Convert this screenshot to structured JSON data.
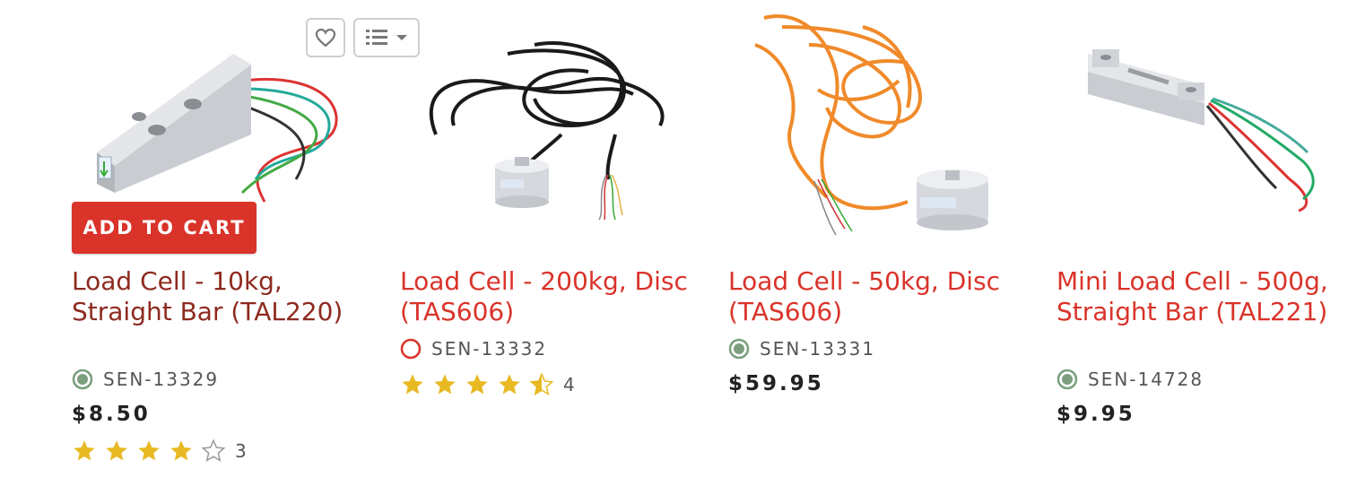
{
  "actions": {
    "add_to_cart_label": "ADD TO CART",
    "wishlist_icon": "heart-icon",
    "list_icon": "list-icon",
    "dropdown_icon": "caret-down-icon"
  },
  "colors": {
    "brand_red": "#d9332a",
    "visited_red": "#8e2a1f",
    "in_stock_green": "#7a9e7e",
    "out_of_stock_red": "#d9332a",
    "star_gold": "#e8b923"
  },
  "products": [
    {
      "title": "Load Cell - 10kg, Straight Bar (TAL220)",
      "sku": "SEN-13329",
      "stock": "in-stock",
      "price": "$8.50",
      "rating": 4,
      "review_count": "3"
    },
    {
      "title": "Load Cell - 200kg, Disc (TAS606)",
      "sku": "SEN-13332",
      "stock": "out-of-stock",
      "price": "",
      "rating": 4.5,
      "review_count": "4"
    },
    {
      "title": "Load Cell - 50kg, Disc (TAS606)",
      "sku": "SEN-13331",
      "stock": "in-stock",
      "price": "$59.95",
      "rating": 0,
      "review_count": ""
    },
    {
      "title": "Mini Load Cell - 500g, Straight Bar (TAL221)",
      "sku": "SEN-14728",
      "stock": "in-stock",
      "price": "$9.95",
      "rating": 0,
      "review_count": ""
    }
  ]
}
